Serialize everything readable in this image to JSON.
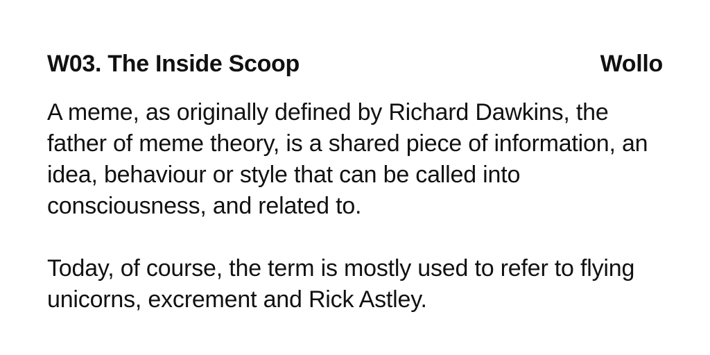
{
  "header": {
    "title": "W03. The Inside Scoop",
    "brand": "Wollo"
  },
  "content": {
    "paragraphs": [
      "A meme, as originally defined by Richard Dawkins, the father of meme theory, is a shared piece of information, an idea, behaviour or style that can be called into consciousness, and related to.",
      "Today, of course, the term is mostly used to refer to flying unicorns, excrement and Rick Astley."
    ]
  },
  "colors": {
    "background": "#ffffff",
    "text": "#111111"
  }
}
